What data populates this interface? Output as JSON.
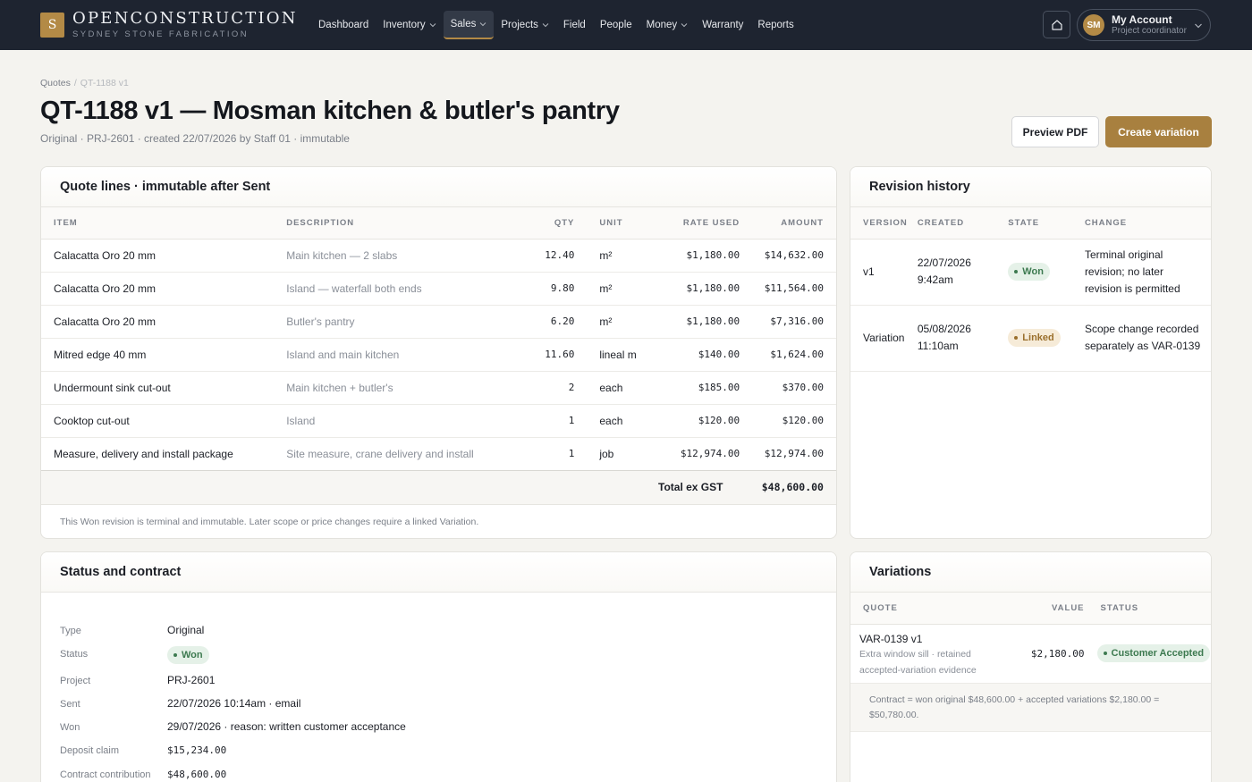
{
  "brand": {
    "logo_letter": "S",
    "name": "OPENCONSTRUCTION",
    "sub": "SYDNEY STONE FABRICATION"
  },
  "nav": {
    "items": [
      {
        "label": "Dashboard"
      },
      {
        "label": "Inventory"
      },
      {
        "label": "Sales"
      },
      {
        "label": "Projects"
      },
      {
        "label": "Field"
      },
      {
        "label": "People"
      },
      {
        "label": "Money"
      },
      {
        "label": "Warranty"
      },
      {
        "label": "Reports"
      }
    ]
  },
  "account": {
    "initials": "SM",
    "name": "My Account",
    "role": "Project coordinator"
  },
  "breadcrumb": {
    "parent": "Quotes",
    "sep": "/",
    "current": "QT-1188 v1"
  },
  "page": {
    "title": "QT-1188 v1 — Mosman kitchen & butler's pantry",
    "meta": "Original · PRJ-2601 · created 22/07/2026 by Staff 01 · immutable",
    "preview_label": "Preview PDF",
    "create_label": "Create variation"
  },
  "quote_lines": {
    "title": "Quote lines · immutable after Sent",
    "headers": [
      "ITEM",
      "DESCRIPTION",
      "QTY",
      "UNIT",
      "RATE USED",
      "AMOUNT"
    ],
    "rows": [
      {
        "item": "Calacatta Oro 20 mm",
        "desc": "Main kitchen — 2 slabs",
        "qty": "12.40",
        "unit": "m²",
        "rate": "$1,180.00",
        "amount": "$14,632.00"
      },
      {
        "item": "Calacatta Oro 20 mm",
        "desc": "Island — waterfall both ends",
        "qty": "9.80",
        "unit": "m²",
        "rate": "$1,180.00",
        "amount": "$11,564.00"
      },
      {
        "item": "Calacatta Oro 20 mm",
        "desc": "Butler's pantry",
        "qty": "6.20",
        "unit": "m²",
        "rate": "$1,180.00",
        "amount": "$7,316.00"
      },
      {
        "item": "Mitred edge 40 mm",
        "desc": "Island and main kitchen",
        "qty": "11.60",
        "unit": "lineal m",
        "rate": "$140.00",
        "amount": "$1,624.00"
      },
      {
        "item": "Undermount sink cut-out",
        "desc": "Main kitchen + butler's",
        "qty": "2",
        "unit": "each",
        "rate": "$185.00",
        "amount": "$370.00"
      },
      {
        "item": "Cooktop cut-out",
        "desc": "Island",
        "qty": "1",
        "unit": "each",
        "rate": "$120.00",
        "amount": "$120.00"
      },
      {
        "item": "Measure, delivery and install package",
        "desc": "Site measure, crane delivery and install",
        "qty": "1",
        "unit": "job",
        "rate": "$12,974.00",
        "amount": "$12,974.00"
      }
    ],
    "total_label": "Total ex GST",
    "total_value": "$48,600.00",
    "footnote": "This Won revision is terminal and immutable. Later scope or price changes require a linked Variation."
  },
  "revision_history": {
    "title": "Revision history",
    "headers": [
      "VERSION",
      "CREATED",
      "STATE",
      "CHANGE"
    ],
    "rows": [
      {
        "version": "v1",
        "created_date": "22/07/2026",
        "created_time": "9:42am",
        "state": "Won",
        "change": "Terminal original revision; no later revision is permitted"
      },
      {
        "version": "Variation",
        "created_date": "05/08/2026",
        "created_time": "11:10am",
        "state": "Linked",
        "change": "Scope change recorded separately as VAR-0139"
      }
    ]
  },
  "status_contract": {
    "title": "Status and contract",
    "fields": [
      {
        "key": "Type",
        "value": "Original"
      },
      {
        "key": "Status",
        "value": "Won"
      },
      {
        "key": "Project",
        "value": "PRJ-2601"
      },
      {
        "key": "Sent",
        "value": "22/07/2026 10:14am · email"
      },
      {
        "key": "Won",
        "value": "29/07/2026 · reason: written customer acceptance"
      },
      {
        "key": "Deposit claim",
        "value": "$15,234.00"
      },
      {
        "key": "Contract contribution",
        "value": "$48,600.00"
      }
    ]
  },
  "variations": {
    "title": "Variations",
    "headers": [
      "QUOTE",
      "VALUE",
      "STATUS"
    ],
    "rows": [
      {
        "quote": "VAR-0139 v1",
        "note": "Extra window sill · retained accepted-variation evidence",
        "value": "$2,180.00",
        "status": "Customer Accepted"
      }
    ],
    "summary": "Contract = won original $48,600.00 + accepted variations $2,180.00 = $50,780.00."
  },
  "colors": {
    "topbar": "#1e2430",
    "accent": "#a8803f",
    "won": "#3d7a50",
    "linked": "#9a6f2c"
  },
  "icons": {
    "home": "home-icon",
    "chevron": "chevron-down-icon"
  }
}
